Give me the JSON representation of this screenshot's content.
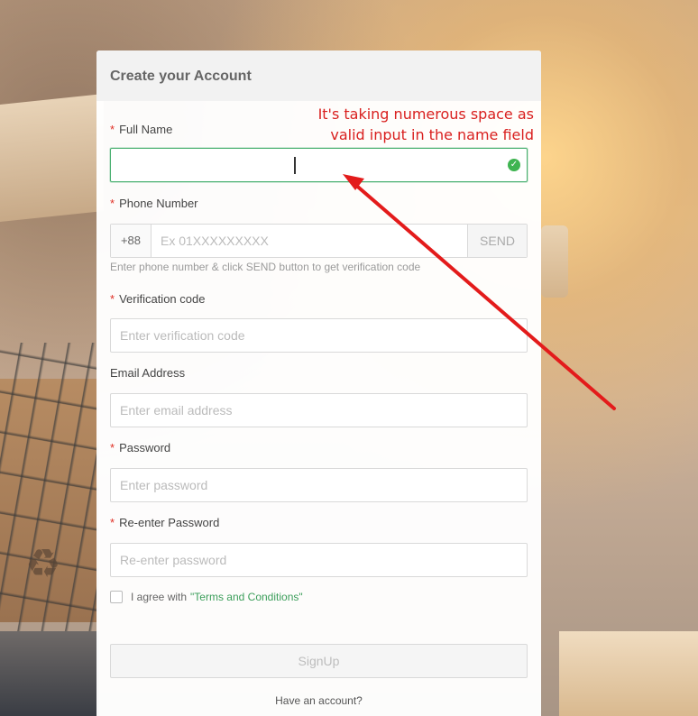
{
  "form": {
    "title": "Create your Account",
    "required_mark": "*",
    "full_name": {
      "label": "Full Name",
      "value": "",
      "status": "valid"
    },
    "phone": {
      "label": "Phone Number",
      "prefix": "+88",
      "placeholder": "Ex 01XXXXXXXXX",
      "send_label": "SEND",
      "hint": "Enter phone number & click SEND button to get verification code"
    },
    "verification": {
      "label": "Verification code",
      "placeholder": "Enter verification code"
    },
    "email": {
      "label": "Email Address",
      "placeholder": "Enter email address"
    },
    "password": {
      "label": "Password",
      "placeholder": "Enter password"
    },
    "reenter": {
      "label": "Re-enter Password",
      "placeholder": "Re-enter password"
    },
    "agree": {
      "text": "I agree with",
      "link": "\"Terms and Conditions\"",
      "checked": false
    },
    "signup_label": "SignUp",
    "have_account": "Have an account?"
  },
  "annotation": {
    "line1": "It's taking numerous space as",
    "line2": "valid input in the name field"
  },
  "colors": {
    "accent_green": "#49b070",
    "required_red": "#e02e24",
    "annotation_red": "#d9201f"
  },
  "icons": {
    "valid": "check-circle-icon",
    "recycle": "recycle-icon",
    "annotation_arrow": "arrow-icon"
  }
}
